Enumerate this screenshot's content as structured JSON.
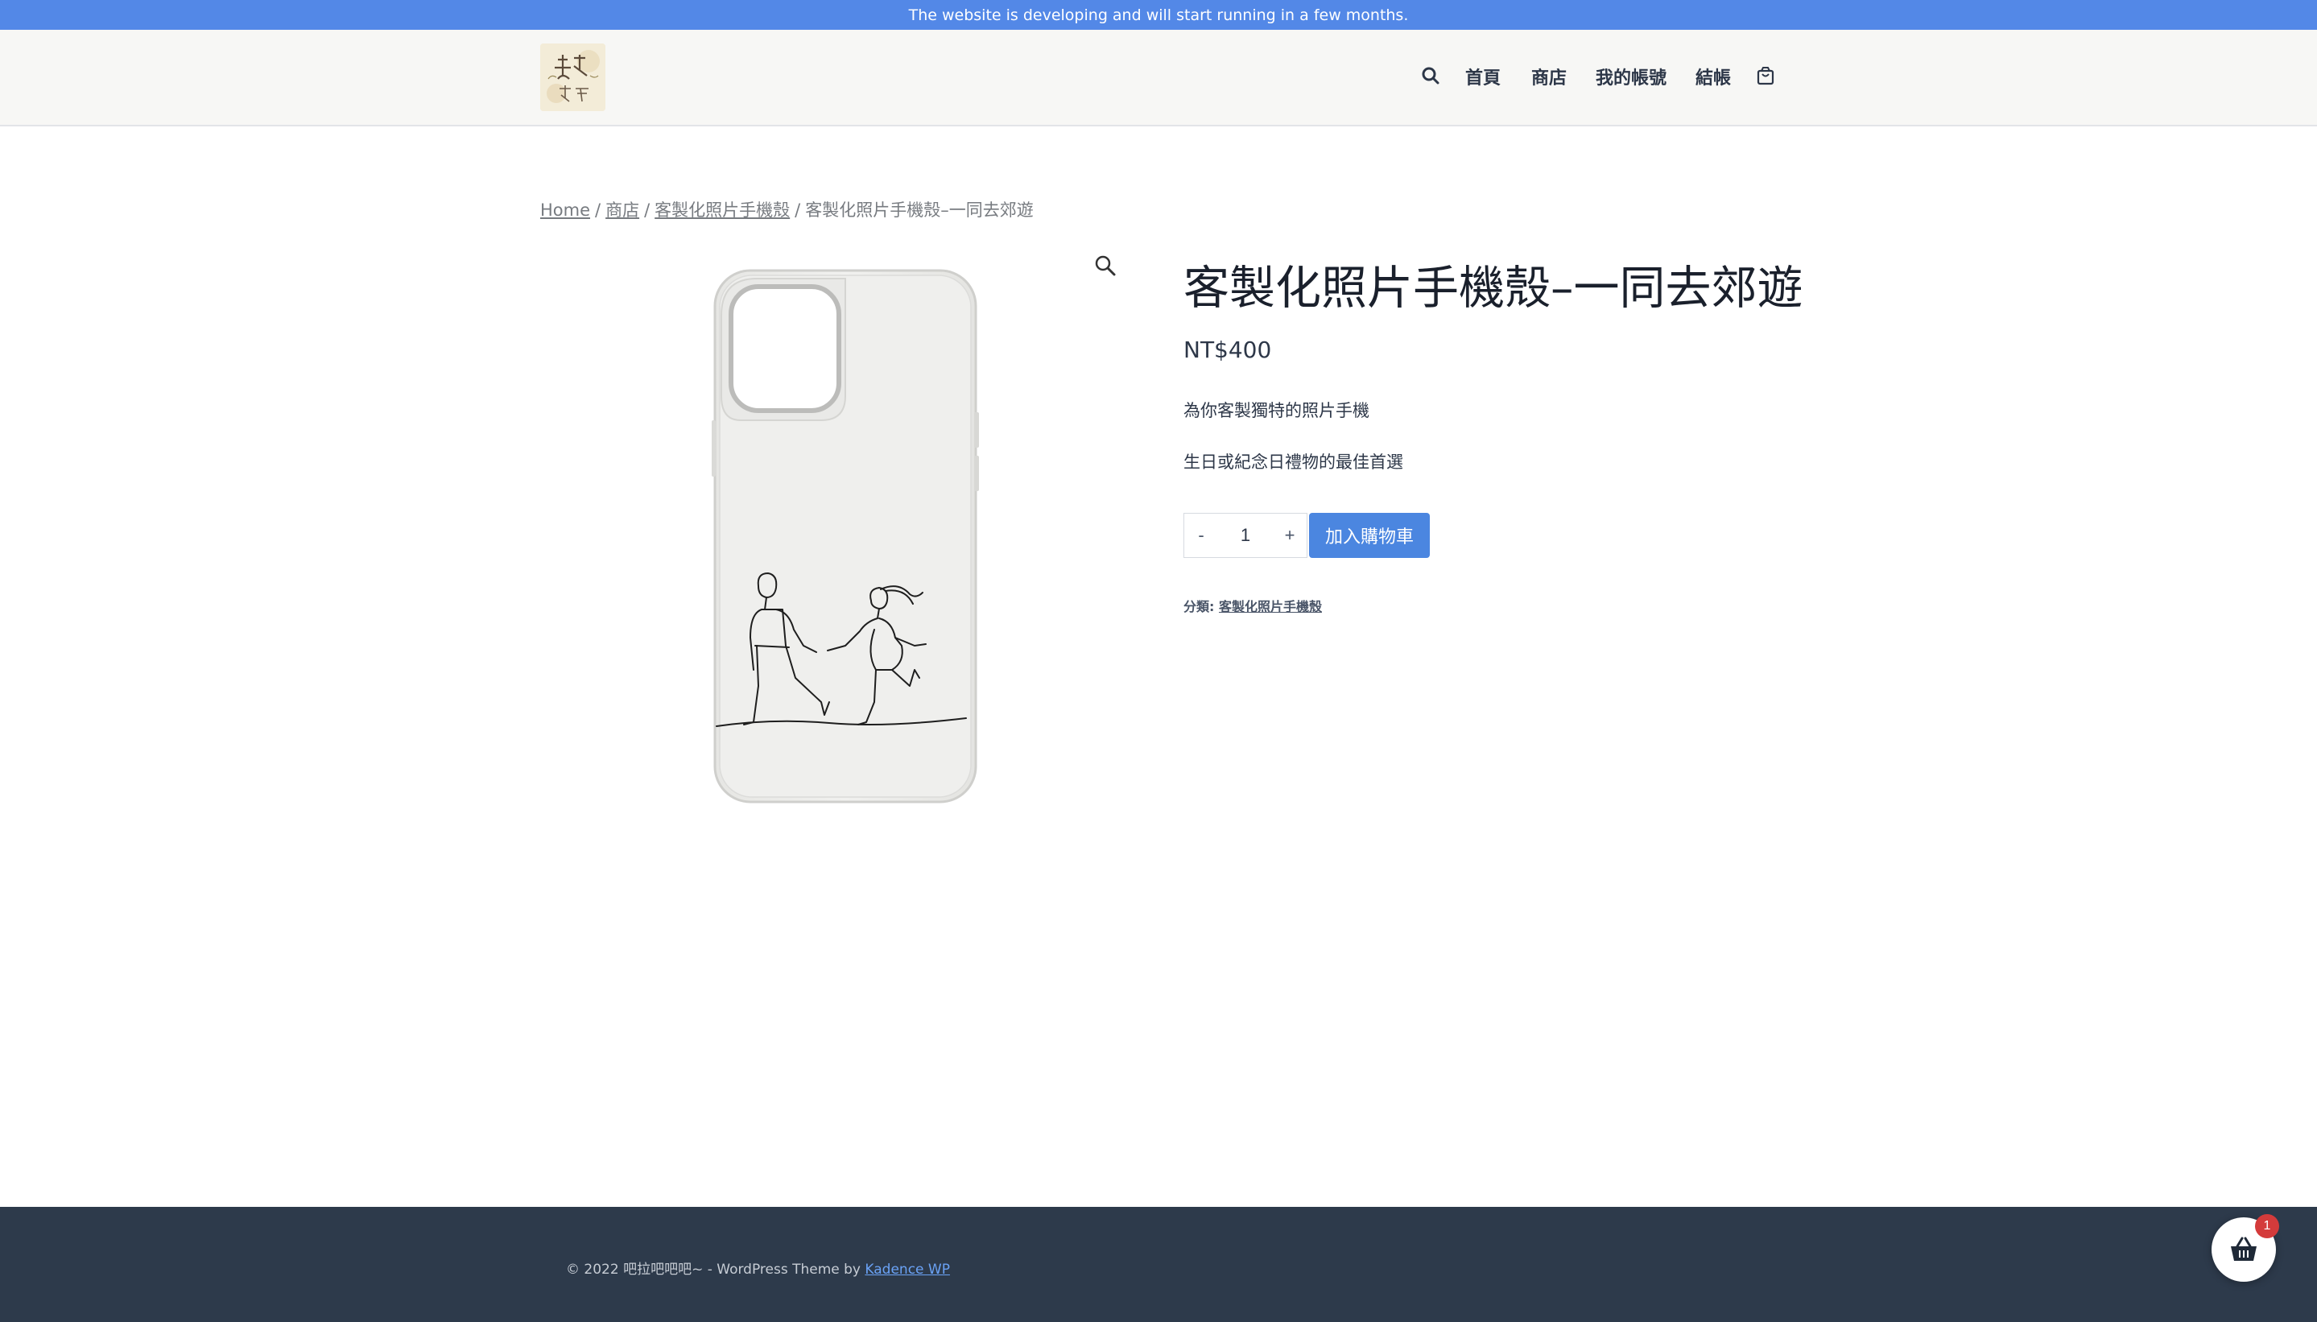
{
  "notice": {
    "text": "The website is developing and will start running in a few months."
  },
  "header": {
    "logo_alt": "殼不殻以",
    "nav": [
      {
        "label": "首頁"
      },
      {
        "label": "商店"
      },
      {
        "label": "我的帳號"
      },
      {
        "label": "結帳"
      }
    ],
    "icons": [
      "search-icon",
      "cart-icon"
    ]
  },
  "breadcrumb": {
    "items": [
      {
        "label": "Home"
      },
      {
        "label": "商店"
      },
      {
        "label": "客製化照片手機殼"
      }
    ],
    "current": "客製化照片手機殼–一同去郊遊"
  },
  "product": {
    "title": "客製化照片手機殼–一同去郊遊",
    "price": "NT$400",
    "description": [
      "為你客製獨特的照片手機",
      "生日或紀念日禮物的最佳首選"
    ],
    "quantity": "1",
    "qty_minus": "-",
    "qty_plus": "+",
    "add_to_cart": "加入購物車",
    "category_label": "分類:",
    "category": "客製化照片手機殼"
  },
  "footer": {
    "copyright": "© 2022 吧拉吧吧吧~ - WordPress Theme by",
    "theme_link": "Kadence WP"
  },
  "floating_cart": {
    "count": "1"
  },
  "colors": {
    "accent": "#4b86e0",
    "notice_bg": "#5388e7",
    "footer_bg": "#2d3a4b",
    "badge": "#d43b3b"
  }
}
